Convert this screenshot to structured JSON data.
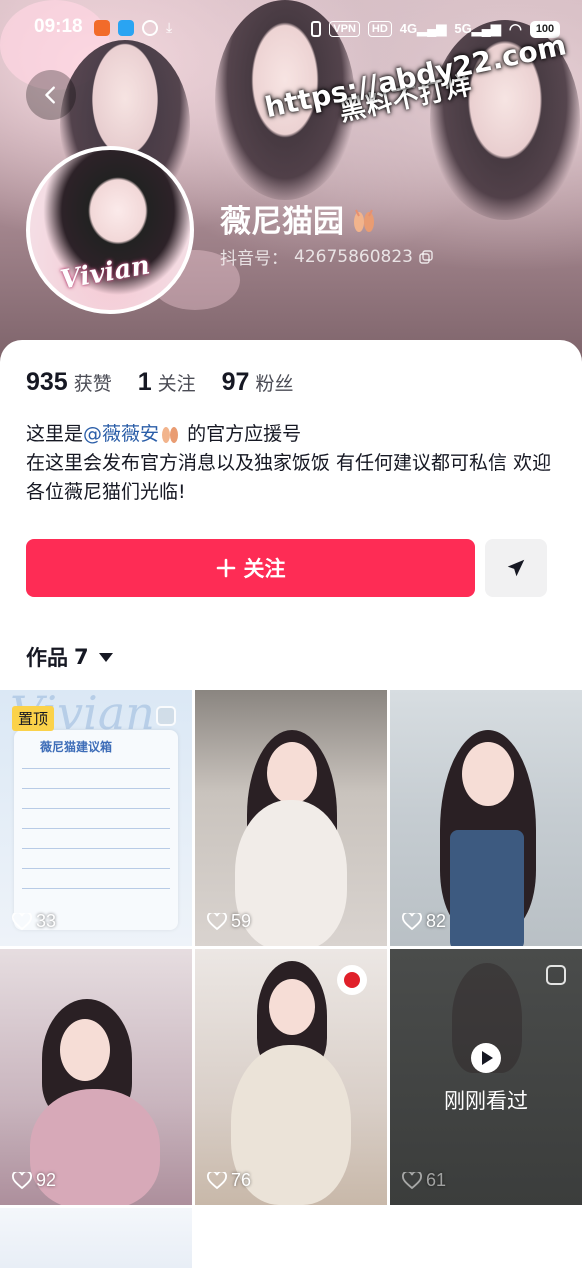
{
  "status_bar": {
    "time": "09:18",
    "vpn": "VPN",
    "hd": "HD",
    "net1": "4G",
    "net2": "5G",
    "battery": "100"
  },
  "watermark": {
    "line1": "黑料不打烊",
    "line2": "https://abdy22.com"
  },
  "profile": {
    "avatar_text": "Vivian",
    "name": "薇尼猫园",
    "id_label": "抖音号：",
    "id_value": "42675860823"
  },
  "stats": [
    {
      "value": "935",
      "label": "获赞"
    },
    {
      "value": "1",
      "label": "关注"
    },
    {
      "value": "97",
      "label": "粉丝"
    }
  ],
  "bio": {
    "line1_prefix": "这里是",
    "mention": "@薇薇安",
    "line1_suffix": " 的官方应援号",
    "line2": "在这里会发布官方消息以及独家饭饭 有任何建议都可私信 欢迎各位薇尼猫们光临!"
  },
  "actions": {
    "follow_label": "关注"
  },
  "works_tab": {
    "label": "作品",
    "count": "7"
  },
  "videos": [
    {
      "likes": "33",
      "pinned_label": "置顶",
      "title": "薇尼猫建议箱",
      "bg_word": "Vivian"
    },
    {
      "likes": "59"
    },
    {
      "likes": "82"
    },
    {
      "likes": "92"
    },
    {
      "likes": "76"
    },
    {
      "likes": "61",
      "recent_label": "刚刚看过"
    }
  ],
  "colors": {
    "accent": "#fe2c55",
    "mention": "#2b5ea8",
    "pin": "#fbd24a"
  }
}
